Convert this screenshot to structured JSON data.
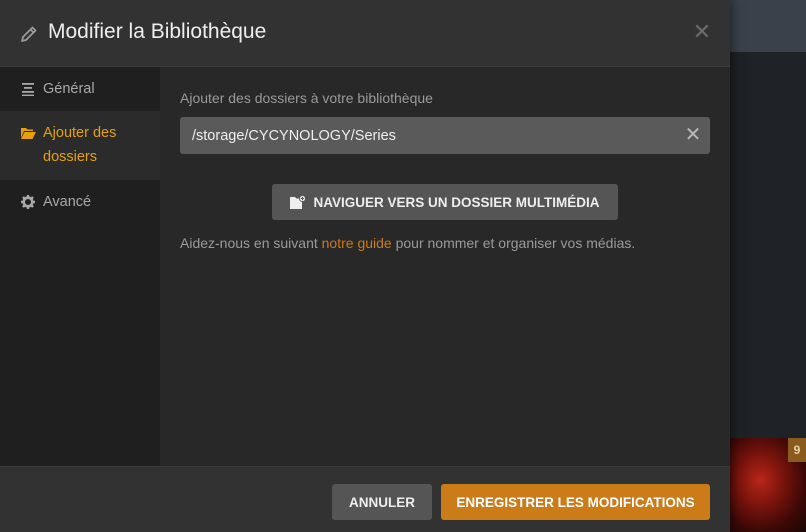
{
  "modal": {
    "title": "Modifier la Bibliothèque",
    "title_icon": "pencil-icon",
    "close_icon": "close-icon"
  },
  "sidebar": {
    "items": [
      {
        "label": "Général",
        "icon": "list-icon",
        "active": false
      },
      {
        "label": "Ajouter des dossiers",
        "icon": "folder-open-icon",
        "active": true
      },
      {
        "label": "Avancé",
        "icon": "gear-icon",
        "active": false
      }
    ]
  },
  "main": {
    "field_label": "Ajouter des dossiers à votre bibliothèque",
    "folder_value": "/storage/CYCYNOLOGY/Series",
    "browse_label": "NAVIGUER VERS UN DOSSIER MULTIMÉDIA",
    "browse_icon": "folder-add-icon",
    "help_prefix": "Aidez-nous en suivant ",
    "help_link": "notre guide",
    "help_suffix": " pour nommer et organiser vos médias."
  },
  "footer": {
    "cancel_label": "ANNULER",
    "save_label": "ENREGISTRER LES MODIFICATIONS"
  },
  "background": {
    "badge": "9"
  },
  "colors": {
    "accent": "#cc7b19",
    "active_sidebar": "#e5a00d",
    "modal_bg": "#282828",
    "sidebar_bg": "#1f1f1f"
  }
}
